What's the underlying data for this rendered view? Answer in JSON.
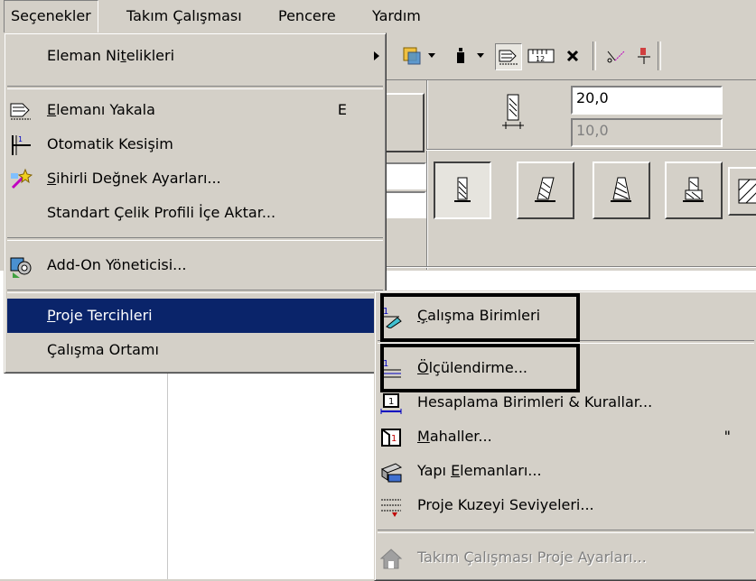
{
  "menubar": {
    "items": [
      {
        "label": "Seçenekler",
        "open": true
      },
      {
        "label": "Takım Çalışması"
      },
      {
        "label": "Pencere"
      },
      {
        "label": "Yardım"
      }
    ]
  },
  "infobox": {
    "height_value": "20,0",
    "offset_value": "10,0"
  },
  "menu": {
    "items": [
      {
        "label": "Eleman Nitelikleri",
        "icon": null,
        "submenu": true
      },
      {
        "label": "Elemanı Yakala",
        "shortcut": "E",
        "icon": "magnet-grab-icon"
      },
      {
        "label": "Otomatik Kesişim",
        "icon": "auto-intersect-icon"
      },
      {
        "label": "Sihirli Değnek Ayarları...",
        "icon": "magic-wand-icon"
      },
      {
        "label": "Standart Çelik Profili İçe Aktar...",
        "icon": null
      },
      {
        "label": "Add-On Yöneticisi...",
        "icon": "addon-manager-icon"
      },
      {
        "label": "Proje Tercihleri",
        "icon": null,
        "submenu": true,
        "selected": true
      },
      {
        "label": "Çalışma Ortamı",
        "icon": null,
        "submenu": true
      }
    ]
  },
  "submenu": {
    "items": [
      {
        "label": "Çalışma Birimleri",
        "icon": "working-units-icon",
        "highlighted": true
      },
      {
        "label": "Ölçülendirme...",
        "icon": "dimensioning-icon",
        "highlighted": true
      },
      {
        "label": "Hesaplama Birimleri & Kurallar...",
        "icon": "calc-units-icon"
      },
      {
        "label": "Mahaller...",
        "icon": "zones-icon",
        "shortcut": "\""
      },
      {
        "label": "Yapı Elemanları...",
        "icon": "construction-elements-icon"
      },
      {
        "label": "Proje Kuzeyi Seviyeleri...",
        "icon": "story-levels-icon"
      },
      {
        "label": "Takım Çalışması Proje Ayarları...",
        "icon": "teamwork-house-icon",
        "disabled": true
      }
    ]
  },
  "colors": {
    "selection": "#0a246a",
    "face": "#d4d0c8",
    "highlight_box": "#000000"
  }
}
